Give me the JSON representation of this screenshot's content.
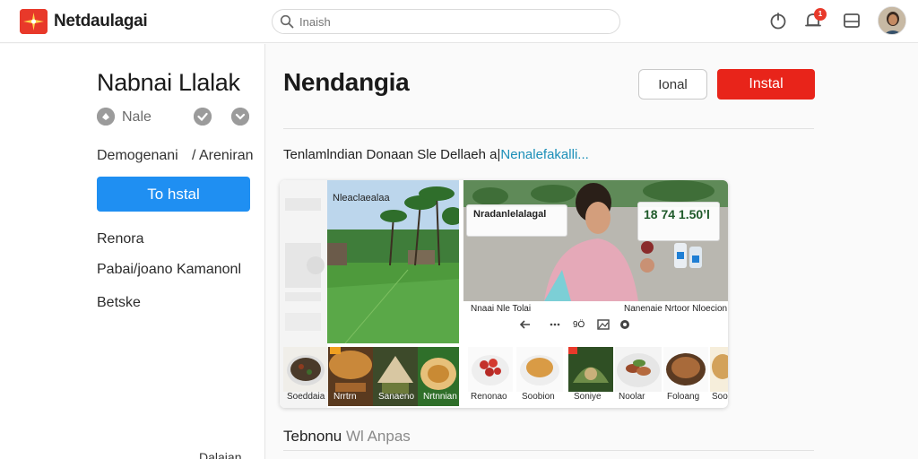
{
  "header": {
    "brand": "Netdaulagai",
    "search_placeholder": "Inaish",
    "notification_count": "1",
    "brand_color": "#e8392a"
  },
  "sidebar": {
    "title": "Nabnai Llalak",
    "mini_label": "Nale",
    "category": "Demogenani",
    "category_alt": "/ Areniran",
    "install_label": "To hstal",
    "links": [
      "Renora",
      "Pabai/joano Kamanonl",
      "Betske"
    ],
    "bottom_label": "Dalaian"
  },
  "main": {
    "title": "Nendangia",
    "secondary_button": "Ional",
    "install_button": "Instal",
    "description": "Tenlamlndian Donaan Sle Dellaeh a|",
    "description_link": "Nenalefakalli...",
    "gallery": {
      "shot1_label": "Nleaclaealaa",
      "shot2_label": "Nradanlelalagal",
      "shot2_caption": "Nnaai Nle Tolai",
      "shot2_num": "9Ö",
      "shot2_caption2": "Nanenaie Nrtoor Nloecion",
      "price_text": "18 74 1.50ʼl",
      "foods": [
        "Soeddaia",
        "Nrrtrn",
        "Sanaeno",
        "Nrtnnian",
        "Renonao",
        "Soobion",
        "Soniye",
        "Noolar",
        "Foloang",
        "Soop"
      ]
    },
    "section_title": "Tebnonu",
    "section_title_muted": "Wl Anpas"
  },
  "colors": {
    "primary_blue": "#1f8ff2",
    "install_red": "#e8241a",
    "link_teal": "#1b8fb8"
  }
}
